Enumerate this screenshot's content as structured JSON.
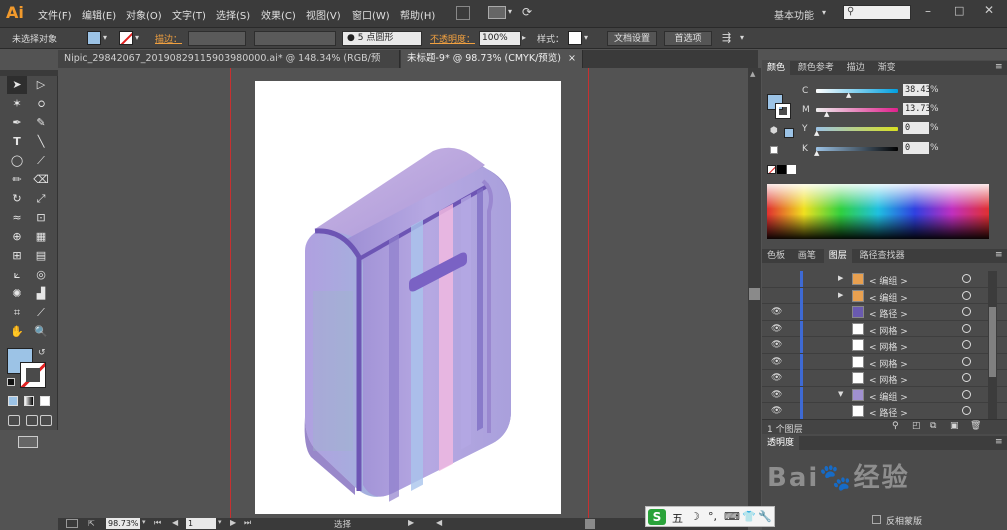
{
  "app": {
    "logo": "Ai"
  },
  "menu": [
    "文件(F)",
    "编辑(E)",
    "对象(O)",
    "文字(T)",
    "选择(S)",
    "效果(C)",
    "视图(V)",
    "窗口(W)",
    "帮助(H)"
  ],
  "workspace": "基本功能",
  "options": {
    "no_selection": "未选择对象",
    "stroke_label": "描边：",
    "brush_label": "5 点圆形",
    "opacity_label": "不透明度：",
    "opacity_value": "100%",
    "style_label": "样式：",
    "doc_settings": "文档设置",
    "preferences": "首选项"
  },
  "tabs": [
    {
      "label": "Nipic_29842067_20190829115903980000.ai* @ 148.34% (RGB/预览)",
      "close": "×"
    },
    {
      "label": "未标题-9* @ 98.73% (CMYK/预览)",
      "close": "×"
    }
  ],
  "status": {
    "zoom": "98.73%",
    "page": "1",
    "mode": "选择"
  },
  "color_panel": {
    "tabs": [
      "颜色",
      "颜色参考",
      "描边",
      "渐变"
    ],
    "channels": [
      {
        "label": "C",
        "value": "38.43",
        "pct": "%",
        "level": 0.38
      },
      {
        "label": "M",
        "value": "13.73",
        "pct": "%",
        "level": 0.14
      },
      {
        "label": "Y",
        "value": "0",
        "pct": "%",
        "level": 0.0
      },
      {
        "label": "K",
        "value": "0",
        "pct": "%",
        "level": 0.0
      }
    ],
    "fill_color": "#9cc3e6"
  },
  "layers_panel": {
    "tabs": [
      "色板",
      "画笔",
      "图层",
      "路径查找器"
    ],
    "rows": [
      {
        "label": "< 编组 >",
        "eye": "",
        "arrow": "▶"
      },
      {
        "label": "< 编组 >",
        "eye": "",
        "arrow": "▶"
      },
      {
        "label": "< 路径 >",
        "eye": "👁",
        "arrow": ""
      },
      {
        "label": "< 网格 >",
        "eye": "👁",
        "arrow": ""
      },
      {
        "label": "< 网格 >",
        "eye": "👁",
        "arrow": ""
      },
      {
        "label": "< 网格 >",
        "eye": "👁",
        "arrow": ""
      },
      {
        "label": "< 网格 >",
        "eye": "👁",
        "arrow": ""
      },
      {
        "label": "< 编组 >",
        "eye": "👁",
        "arrow": "▼"
      },
      {
        "label": "< 路径 >",
        "eye": "👁",
        "arrow": ""
      }
    ],
    "footer": "1 个图层"
  },
  "transparency_panel": {
    "title": "透明度",
    "invert_mask": "反相蒙版"
  },
  "ime": {
    "logo": "S",
    "items": [
      "五",
      "☽",
      "°,",
      "⌨",
      "👕",
      "🔧"
    ]
  }
}
